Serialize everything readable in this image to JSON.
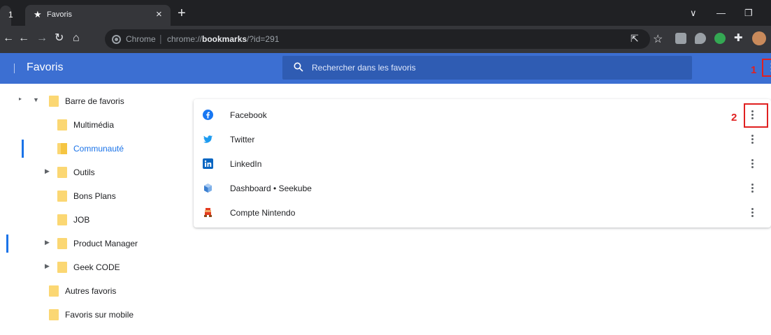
{
  "browser": {
    "tab_stub_label": "1",
    "tab_title": "Favoris",
    "omnibox": {
      "site": "Chrome",
      "separator": "|",
      "url_prefix": "chrome://",
      "url_bold": "bookmarks",
      "url_suffix": "/?id=291"
    }
  },
  "header": {
    "title": "Favoris",
    "search_placeholder": "Rechercher dans les favoris"
  },
  "annotations": {
    "mark1": "1",
    "mark2": "2",
    "color": "#e02020"
  },
  "colors": {
    "header_bg": "#3c6fd2",
    "accent": "#1a73e8",
    "folder": "#fbd773"
  },
  "sidebar": {
    "items": [
      {
        "label": "Barre de favoris",
        "expanded": true,
        "has_arrow": true
      },
      {
        "label": "Multimédia",
        "has_arrow": false
      },
      {
        "label": "Communauté",
        "selected": true,
        "has_arrow": false
      },
      {
        "label": "Outils",
        "has_arrow": true
      },
      {
        "label": "Bons Plans",
        "has_arrow": false
      },
      {
        "label": "JOB",
        "has_arrow": false
      },
      {
        "label": "Product Manager",
        "has_arrow": true
      },
      {
        "label": "Geek CODE",
        "has_arrow": true
      },
      {
        "label": "Autres favoris",
        "has_arrow": false
      },
      {
        "label": "Favoris sur mobile",
        "has_arrow": false
      }
    ]
  },
  "bookmarks": [
    {
      "title": "Facebook",
      "icon": "facebook-icon"
    },
    {
      "title": "Twitter",
      "icon": "twitter-icon"
    },
    {
      "title": "LinkedIn",
      "icon": "linkedin-icon"
    },
    {
      "title": "Dashboard • Seekube",
      "icon": "seekube-icon"
    },
    {
      "title": "Compte Nintendo",
      "icon": "nintendo-icon"
    }
  ]
}
